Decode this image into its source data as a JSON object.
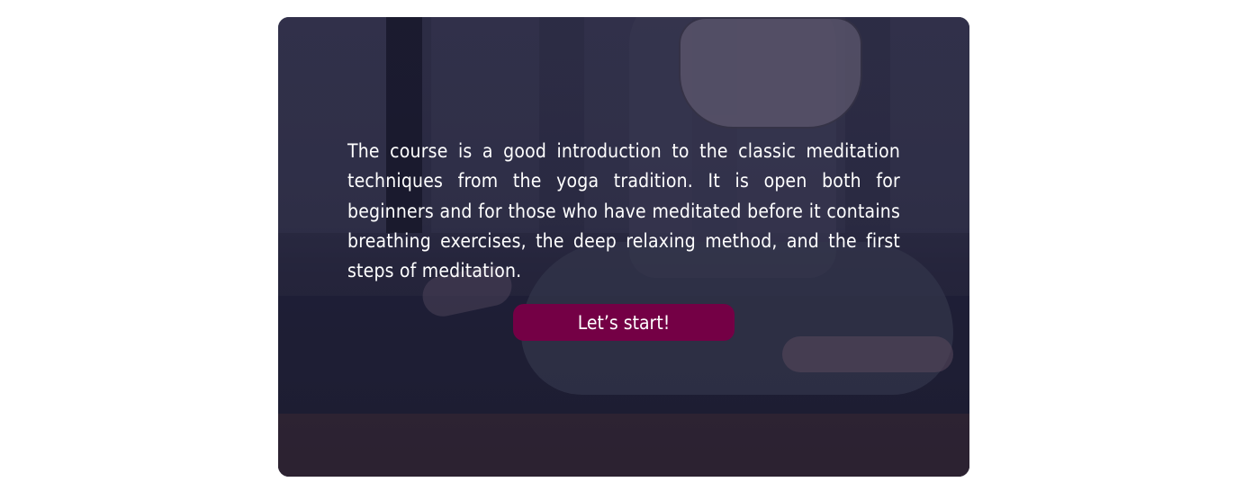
{
  "hero": {
    "description": "The course is a good introduction to the classic meditation techniques from the yoga tradition. It is open both for beginners and for those who have meditated before it contains breathing exercises, the deep relaxing method, and the first steps of meditation.",
    "cta_label": "Let’s start!"
  },
  "colors": {
    "cta_background": "#740045",
    "overlay": "#151430",
    "text": "#ffffff"
  },
  "image": {
    "semantic_name": "meditation-pose-photo"
  }
}
